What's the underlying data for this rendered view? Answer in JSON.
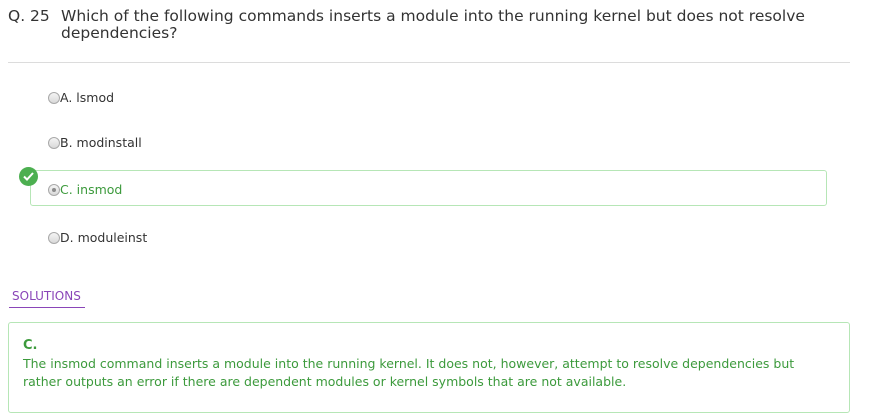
{
  "question": {
    "number": "Q. 25",
    "text": "Which of the following commands inserts a module into the running kernel but does not resolve dependencies?"
  },
  "options": [
    {
      "label": "A. lsmod"
    },
    {
      "label": "B. modinstall"
    },
    {
      "label": "C. insmod",
      "selected": true,
      "correct": true
    },
    {
      "label": "D. moduleinst"
    }
  ],
  "solutions": {
    "tab_label": "SOLUTIONS",
    "answer": "C.",
    "explanation": "The insmod command inserts a module into the running kernel. It does not, however, attempt to resolve dependencies but rather outputs an error if there are dependent modules or kernel symbols that are not available."
  },
  "colors": {
    "correct": "#3c9a3c",
    "accent": "#8a45b8"
  }
}
